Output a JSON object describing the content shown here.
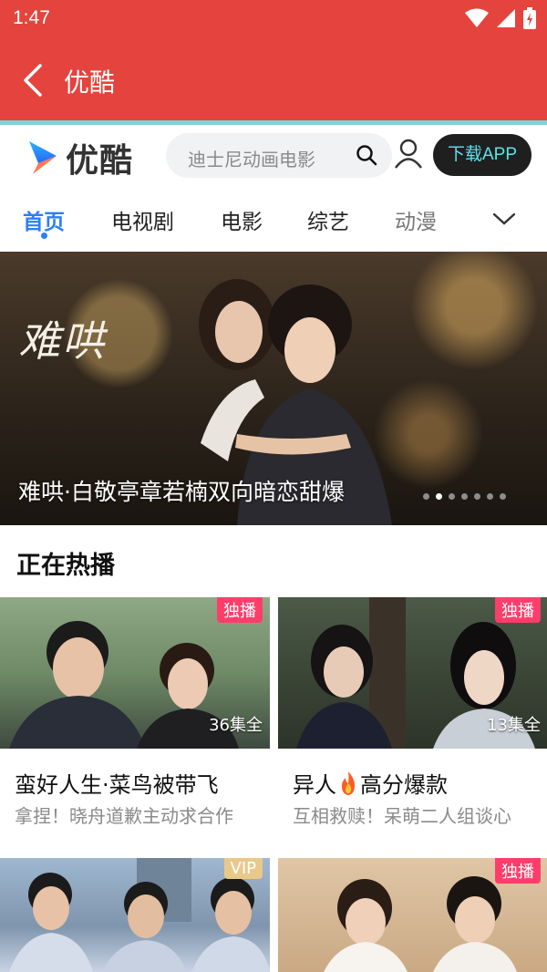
{
  "status_bar": {
    "time": "1:47"
  },
  "app_bar": {
    "title": "优酷"
  },
  "site_header": {
    "logo_text": "优酷",
    "search_placeholder": "迪士尼动画电影",
    "download_label": "下载APP"
  },
  "nav": {
    "tabs": [
      "首页",
      "电视剧",
      "电影",
      "综艺",
      "动漫"
    ],
    "active_index": 0
  },
  "banner": {
    "calligraphy": "难哄",
    "caption": "难哄·白敬亭章若楠双向暗恋甜爆",
    "dot_count": 7,
    "active_dot": 1
  },
  "section": {
    "title": "正在热播"
  },
  "cards": [
    {
      "badge": "独播",
      "episodes": "36集全",
      "title": "蛮好人生·菜鸟被带飞",
      "subtitle": "拿捏！晓舟道歉主动求合作"
    },
    {
      "badge": "独播",
      "episodes": "13集全",
      "title_prefix": "异人",
      "title_suffix": "高分爆款",
      "subtitle": "互相救赎！呆萌二人组谈心"
    },
    {
      "badge": "VIP"
    },
    {
      "badge": "独播"
    }
  ],
  "colors": {
    "accent_red": "#e4443d",
    "tab_active": "#2a7ff6",
    "badge_red": "#ff3d6b",
    "download_text": "#5fe3ea"
  }
}
